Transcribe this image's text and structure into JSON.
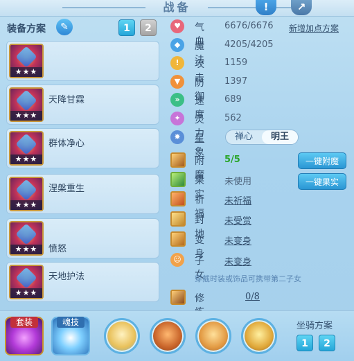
{
  "title": "战备",
  "left": {
    "scheme_label": "装备方案",
    "pages": [
      "1",
      "2"
    ],
    "slots": [
      {
        "name": ""
      },
      {
        "name": "天降甘霖"
      },
      {
        "name": "群体净心"
      },
      {
        "name": "涅槃重生"
      },
      {
        "name": "愤怒"
      },
      {
        "name": "天地护法"
      }
    ],
    "stars": "★★★"
  },
  "stats": [
    {
      "label": "气血",
      "value": "6676/6676",
      "icon": "heart-icon",
      "color": "#e8677a"
    },
    {
      "label": "魔法",
      "value": "4205/4205",
      "icon": "mana-icon",
      "color": "#4aa3e6"
    },
    {
      "label": "攻击",
      "value": "1159",
      "icon": "attack-icon",
      "color": "#f0b63a"
    },
    {
      "label": "防御",
      "value": "1397",
      "icon": "shield-icon",
      "color": "#f0913a"
    },
    {
      "label": "速度",
      "value": "689",
      "icon": "speed-icon",
      "color": "#3bbf86"
    },
    {
      "label": "灵力",
      "value": "562",
      "icon": "spirit-icon",
      "color": "#c774d8"
    }
  ],
  "new_points_link": "新增加点方案",
  "xingxiang": {
    "label": "星象",
    "options": [
      "禅心",
      "明王"
    ],
    "selected": "明王"
  },
  "features": [
    {
      "label": "附魔",
      "value": "5/5",
      "icon": "enchant-icon"
    },
    {
      "label": "果实",
      "value": "未使用",
      "icon": "fruit-icon"
    },
    {
      "label": "祈福",
      "value": "未祈福",
      "icon": "pray-icon"
    },
    {
      "label": "封地",
      "value": "未受赏",
      "icon": "fief-icon"
    },
    {
      "label": "变身",
      "value": "未变身",
      "icon": "transform-icon"
    },
    {
      "label": "子女",
      "value": "未变身",
      "icon": "child-icon"
    }
  ],
  "buttons": {
    "enchant": "一键附魔",
    "fruit": "一键果实"
  },
  "hint": "穿戴时装或饰品可携带第二子女",
  "cultivation": {
    "label": "修炼觉醒",
    "value": "0/8"
  },
  "bottom": {
    "outfit_label": "套装",
    "skill_label": "魂技",
    "mount_label": "坐骑方案",
    "mount_pages": [
      "1",
      "2"
    ]
  },
  "colors": {
    "accent": "#25a7d9",
    "enchant_value": "#2aa52a"
  }
}
